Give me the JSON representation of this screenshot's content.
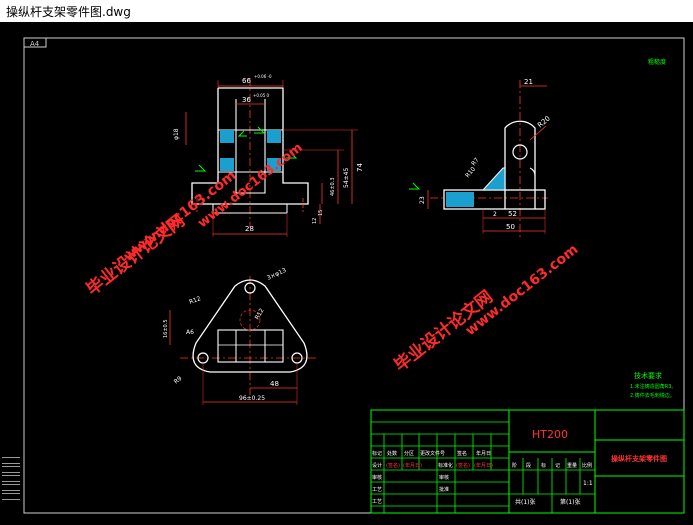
{
  "window": {
    "title": "操纵杆支架零件图.dwg"
  },
  "drawing": {
    "sheet_label": "A4",
    "roughness_note": "粗糙度",
    "watermark_1": "毕业设计论文网",
    "watermark_2": "www.doc163.com",
    "front_view": {
      "dim_overall": "66",
      "dim_overall_tol": "+0.06 -0",
      "dim_inner": "36",
      "dim_inner_tol": "+0.05 0",
      "dim_bottom": "28",
      "dim_hole": "φ18",
      "dim_h74": "74",
      "dim_h54": "54±45",
      "dim_h46": "46±0.3",
      "dim_h15": "15",
      "dim_h12": "12"
    },
    "side_view": {
      "dim_21": "21",
      "dim_r20": "R20",
      "dim_r7": "R7",
      "dim_r10": "R10",
      "dim_23": "23",
      "dim_2": "2",
      "dim_52": "52",
      "dim_50": "50"
    },
    "top_view": {
      "dim_phi": "3×φ13",
      "dim_r12": "R12",
      "dim_rt": "R12",
      "dim_a6": "A6",
      "dim_left": "16±0.5",
      "dim_48": "48",
      "dim_96": "96±0.25",
      "dim_r9": "R9"
    },
    "tech_req": {
      "title": "技术要求",
      "line1": "1.未注铸造圆角R3。",
      "line2": "2.铸件去毛刺锐边。"
    },
    "title_block": {
      "material": "HT200",
      "part_name": "操纵杆支架零件图",
      "row_header": [
        "标记",
        "处数",
        "分区",
        "更改文件号",
        "签名",
        "年月日"
      ],
      "row_design": [
        "设计",
        "(签名)",
        "(年月日)",
        "标准化",
        "(签名)",
        "(年月日)"
      ],
      "stage_labels": [
        "阶",
        "段",
        "标",
        "记",
        "重量",
        "比例"
      ],
      "scale": "1:1",
      "audit": "审核",
      "process": "工艺",
      "approve": "批准",
      "sheets_total": "共(1)张",
      "sheet_no": "第(1)张",
      "col_label_a": "审核",
      "col_label_b": "工艺"
    }
  }
}
